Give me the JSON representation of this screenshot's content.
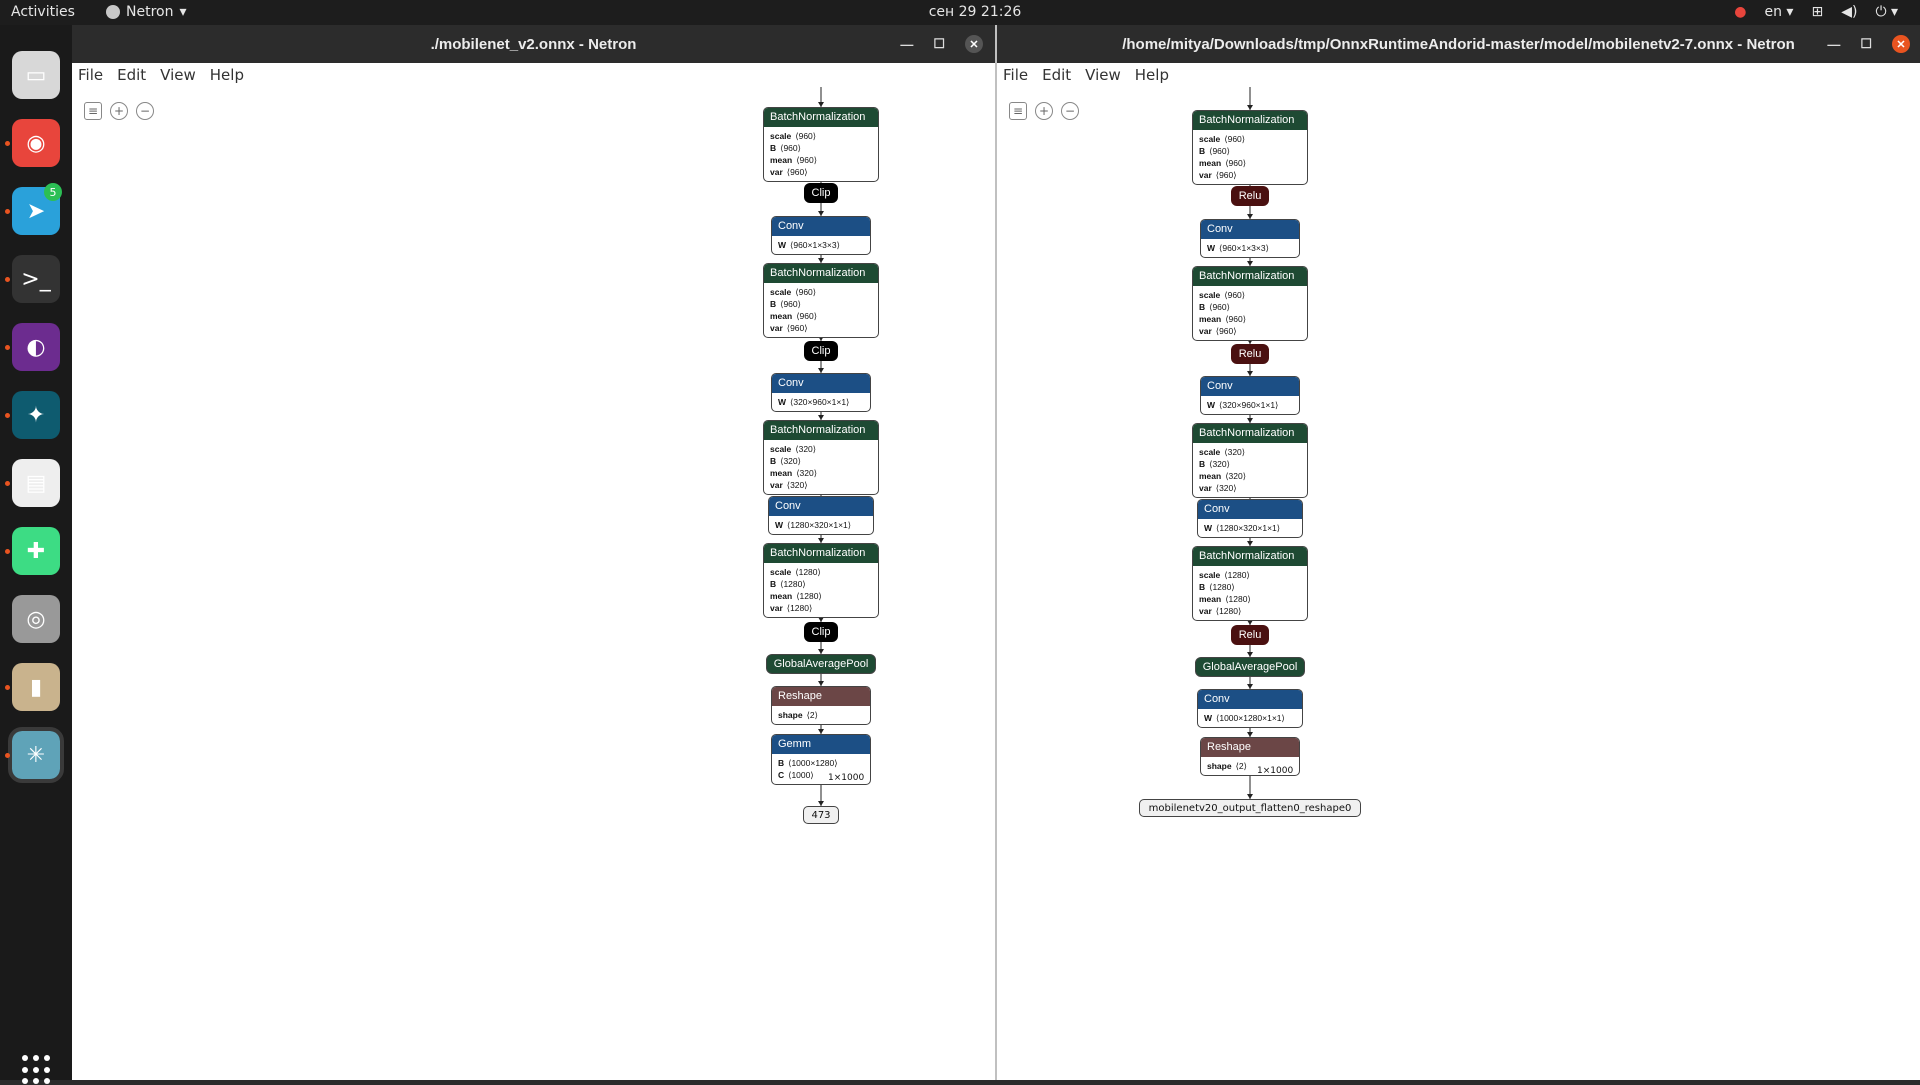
{
  "topbar": {
    "activities": "Activities",
    "app_name": "Netron",
    "clock": "сен 29  21:26",
    "lang": "en"
  },
  "dock": {
    "items": [
      {
        "name": "files-icon",
        "glyph": "▭",
        "bg": "#d8d8d8",
        "dot": false
      },
      {
        "name": "chrome-icon",
        "glyph": "◉",
        "bg": "#e8453c",
        "dot": true
      },
      {
        "name": "telegram-icon",
        "glyph": "➤",
        "bg": "#2aa1da",
        "dot": true,
        "badge": "5"
      },
      {
        "name": "terminal-icon",
        "glyph": ">_",
        "bg": "#333",
        "dot": true
      },
      {
        "name": "tor-icon",
        "glyph": "◐",
        "bg": "#6c2c8f",
        "dot": true
      },
      {
        "name": "gitkraken-icon",
        "glyph": "✦",
        "bg": "#0e5b6f",
        "dot": true
      },
      {
        "name": "reader-icon",
        "glyph": "▤",
        "bg": "#eee",
        "dot": true
      },
      {
        "name": "android-studio-icon",
        "glyph": "✚",
        "bg": "#3ddc84",
        "dot": true
      },
      {
        "name": "magnifier-icon",
        "glyph": "◎",
        "bg": "#999",
        "dot": false
      },
      {
        "name": "archive-icon",
        "glyph": "▮",
        "bg": "#c9b38d",
        "dot": true
      },
      {
        "name": "netron-icon",
        "glyph": "✳",
        "bg": "#5fa3b8",
        "dot": true
      }
    ]
  },
  "left_window": {
    "title": "./mobilenet_v2.onnx - Netron",
    "menu": [
      "File",
      "Edit",
      "View",
      "Help"
    ],
    "nodes": [
      {
        "kind": "bn",
        "op": "BatchNormalization",
        "attrs": [
          [
            "scale",
            "⟨960⟩"
          ],
          [
            "B",
            "⟨960⟩"
          ],
          [
            "mean",
            "⟨960⟩"
          ],
          [
            "var",
            "⟨960⟩"
          ]
        ]
      },
      {
        "kind": "clip",
        "op": "Clip"
      },
      {
        "kind": "conv",
        "op": "Conv",
        "attrs": [
          [
            "W",
            "⟨960×1×3×3⟩"
          ]
        ]
      },
      {
        "kind": "bn",
        "op": "BatchNormalization",
        "attrs": [
          [
            "scale",
            "⟨960⟩"
          ],
          [
            "B",
            "⟨960⟩"
          ],
          [
            "mean",
            "⟨960⟩"
          ],
          [
            "var",
            "⟨960⟩"
          ]
        ]
      },
      {
        "kind": "clip",
        "op": "Clip"
      },
      {
        "kind": "conv",
        "op": "Conv",
        "attrs": [
          [
            "W",
            "⟨320×960×1×1⟩"
          ]
        ]
      },
      {
        "kind": "bn",
        "op": "BatchNormalization",
        "attrs": [
          [
            "scale",
            "⟨320⟩"
          ],
          [
            "B",
            "⟨320⟩"
          ],
          [
            "mean",
            "⟨320⟩"
          ],
          [
            "var",
            "⟨320⟩"
          ]
        ]
      },
      {
        "kind": "conv",
        "op": "Conv",
        "attrs": [
          [
            "W",
            "⟨1280×320×1×1⟩"
          ]
        ]
      },
      {
        "kind": "bn",
        "op": "BatchNormalization",
        "attrs": [
          [
            "scale",
            "⟨1280⟩"
          ],
          [
            "B",
            "⟨1280⟩"
          ],
          [
            "mean",
            "⟨1280⟩"
          ],
          [
            "var",
            "⟨1280⟩"
          ]
        ]
      },
      {
        "kind": "clip",
        "op": "Clip"
      },
      {
        "kind": "gap",
        "op": "GlobalAveragePool"
      },
      {
        "kind": "reshape",
        "op": "Reshape",
        "attrs": [
          [
            "shape",
            "⟨2⟩"
          ]
        ]
      },
      {
        "kind": "gemm",
        "op": "Gemm",
        "attrs": [
          [
            "B",
            "⟨1000×1280⟩"
          ],
          [
            "C",
            "⟨1000⟩"
          ]
        ]
      }
    ],
    "edge_label": "1×1000",
    "output": "473"
  },
  "right_window": {
    "title": "/home/mitya/Downloads/tmp/OnnxRuntimeAndorid-master/model/mobilenetv2-7.onnx - Netron",
    "menu": [
      "File",
      "Edit",
      "View",
      "Help"
    ],
    "nodes": [
      {
        "kind": "bn",
        "op": "BatchNormalization",
        "attrs": [
          [
            "scale",
            "⟨960⟩"
          ],
          [
            "B",
            "⟨960⟩"
          ],
          [
            "mean",
            "⟨960⟩"
          ],
          [
            "var",
            "⟨960⟩"
          ]
        ]
      },
      {
        "kind": "relu",
        "op": "Relu"
      },
      {
        "kind": "conv",
        "op": "Conv",
        "attrs": [
          [
            "W",
            "⟨960×1×3×3⟩"
          ]
        ]
      },
      {
        "kind": "bn",
        "op": "BatchNormalization",
        "attrs": [
          [
            "scale",
            "⟨960⟩"
          ],
          [
            "B",
            "⟨960⟩"
          ],
          [
            "mean",
            "⟨960⟩"
          ],
          [
            "var",
            "⟨960⟩"
          ]
        ]
      },
      {
        "kind": "relu",
        "op": "Relu"
      },
      {
        "kind": "conv",
        "op": "Conv",
        "attrs": [
          [
            "W",
            "⟨320×960×1×1⟩"
          ]
        ]
      },
      {
        "kind": "bn",
        "op": "BatchNormalization",
        "attrs": [
          [
            "scale",
            "⟨320⟩"
          ],
          [
            "B",
            "⟨320⟩"
          ],
          [
            "mean",
            "⟨320⟩"
          ],
          [
            "var",
            "⟨320⟩"
          ]
        ]
      },
      {
        "kind": "conv",
        "op": "Conv",
        "attrs": [
          [
            "W",
            "⟨1280×320×1×1⟩"
          ]
        ]
      },
      {
        "kind": "bn",
        "op": "BatchNormalization",
        "attrs": [
          [
            "scale",
            "⟨1280⟩"
          ],
          [
            "B",
            "⟨1280⟩"
          ],
          [
            "mean",
            "⟨1280⟩"
          ],
          [
            "var",
            "⟨1280⟩"
          ]
        ]
      },
      {
        "kind": "relu",
        "op": "Relu"
      },
      {
        "kind": "gap",
        "op": "GlobalAveragePool"
      },
      {
        "kind": "conv",
        "op": "Conv",
        "attrs": [
          [
            "W",
            "⟨1000×1280×1×1⟩"
          ]
        ]
      },
      {
        "kind": "reshape",
        "op": "Reshape",
        "attrs": [
          [
            "shape",
            "⟨2⟩"
          ]
        ]
      }
    ],
    "edge_label": "1×1000",
    "output": "mobilenetv20_output_flatten0_reshape0"
  }
}
